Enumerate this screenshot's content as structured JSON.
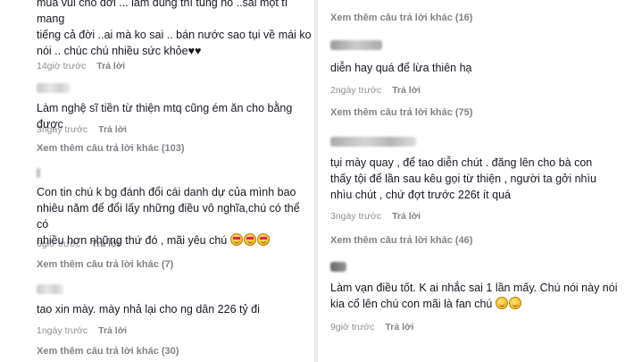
{
  "left": {
    "c1": {
      "lines": [
        "mua vui cho đời ... làm đúng thì tùng nó ..sai một tí mang",
        "tiếng cả đời ..ai mà ko sai .. bán nước sao tụi về mái ko",
        "nói .. chúc chú nhiều sức khỏe♥♥"
      ],
      "time": "14giờ trước",
      "reply": "Trả lời"
    },
    "c2": {
      "text": "Làm nghệ sĩ tiền từ thiện mtq cũng ém ăn cho bằng được",
      "time": "3ngày trước",
      "reply": "Trả lời",
      "more": "Xem thêm câu trả lời khác (103)"
    },
    "c3": {
      "lines": [
        "Con tin chú k bg đánh đổi cái danh dự của mình bao",
        "nhiêu năm để đổi lấy những điều vô nghĩa,chú có thể có",
        "nhiều hơn những thứ đó , mãi yêu chú"
      ],
      "time": "6giờ trước",
      "reply": "Trả lời",
      "more": "Xem thêm câu trả lời khác (7)"
    },
    "c4": {
      "text": "tao xin mày. mày nhả lại cho ng dân 226 tỷ đi",
      "time": "1ngày trước",
      "reply": "Trả lời",
      "more": "Xem thêm câu trả lời khác (30)"
    }
  },
  "right": {
    "more0": "Xem thêm câu trả lời khác (16)",
    "c1": {
      "text": "diễn hay quá để lừa thiên hạ",
      "time": "2ngày trước",
      "reply": "Trả lời",
      "more": "Xem thêm câu trả lời khác (75)"
    },
    "c2": {
      "lines": [
        "tụi mày quay , để tao diễn chút . đăng lên cho bà con",
        "thấy tội để lần sau kêu gọi từ thiện , người ta gởi nhìu",
        "nhìu chút , chứ đợt trước 226t ít quá"
      ],
      "time": "3ngày trước",
      "reply": "Trả lời",
      "more": "Xem thêm câu trả lời khác (46)"
    },
    "c3": {
      "lines": [
        "Làm vạn điều tốt. K ai nhắc sai 1 lần mấy. Chú nói này nói",
        "kia cổ lên chú con mãi là fan chú"
      ],
      "time": "9giờ trước",
      "reply": "Trả lời"
    }
  },
  "colors": {
    "text": "#161823",
    "secondary": "rgba(22,24,35,0.5)",
    "divider": "#eaeaea"
  }
}
